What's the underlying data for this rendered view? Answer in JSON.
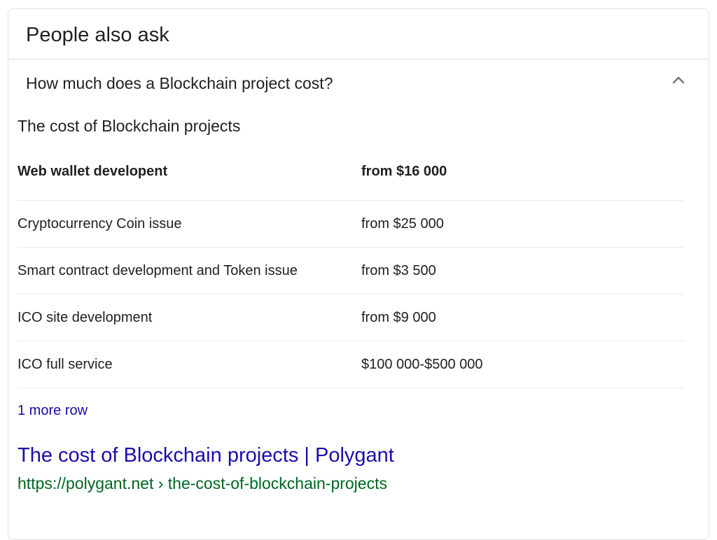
{
  "panel": {
    "title": "People also ask"
  },
  "question": {
    "text": "How much does a Blockchain project cost?",
    "expanded_icon": "chevron-up-icon"
  },
  "answer": {
    "heading": "The cost of Blockchain projects",
    "table": {
      "header": [
        "Web wallet developent",
        "from $16 000"
      ],
      "rows": [
        [
          "Cryptocurrency Coin issue",
          "from $25 000"
        ],
        [
          "Smart contract development and Token issue",
          "from $3 500"
        ],
        [
          "ICO site development",
          "from $9 000"
        ],
        [
          "ICO full service",
          "$100 000-$500 000"
        ]
      ]
    },
    "more_rows_label": "1 more row"
  },
  "result": {
    "title": "The cost of Blockchain projects | Polygant",
    "url": "https://polygant.net › the-cost-of-blockchain-projects"
  },
  "colors": {
    "link": "#1a0dab",
    "url": "#006621",
    "text": "#202124",
    "border": "#dfe1e5"
  }
}
